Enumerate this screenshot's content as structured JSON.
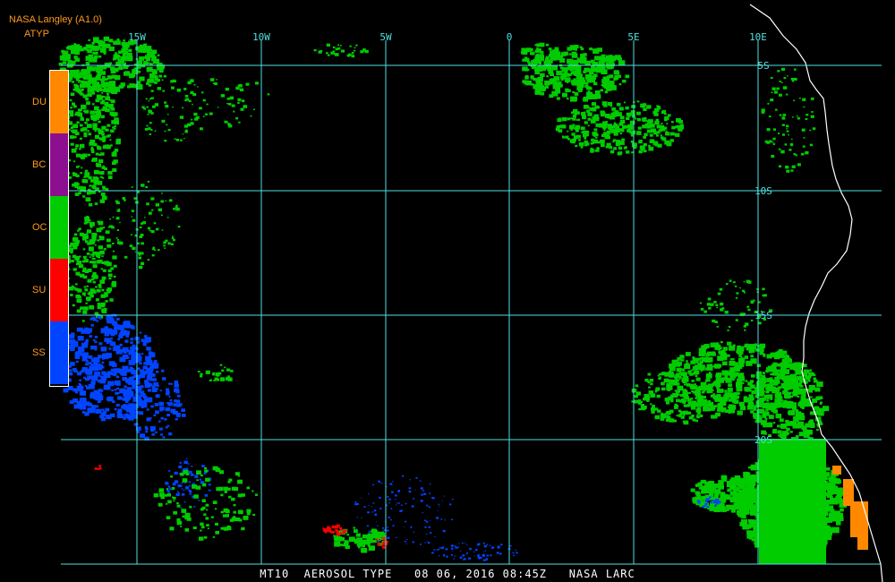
{
  "header": {
    "source": "NASA Langley (A1.0)",
    "product": "ATYP"
  },
  "legend": {
    "classes": [
      {
        "code": "DU",
        "color": "#ff8800"
      },
      {
        "code": "BC",
        "color": "#8b0f8f"
      },
      {
        "code": "OC",
        "color": "#00cc00"
      },
      {
        "code": "SU",
        "color": "#ff0000"
      },
      {
        "code": "SS",
        "color": "#0044ff"
      }
    ]
  },
  "map": {
    "lon_labels": [
      "15W",
      "10W",
      "5W",
      "0",
      "5E",
      "10E"
    ],
    "lat_labels": [
      "5S",
      "10S",
      "15S",
      "20S"
    ],
    "grid_color": "#4fe0e0",
    "coast_color": "#ffffff"
  },
  "footer": {
    "text": "MT10  AEROSOL TYPE   08 06, 2016 08:45Z   NASA LARC"
  }
}
